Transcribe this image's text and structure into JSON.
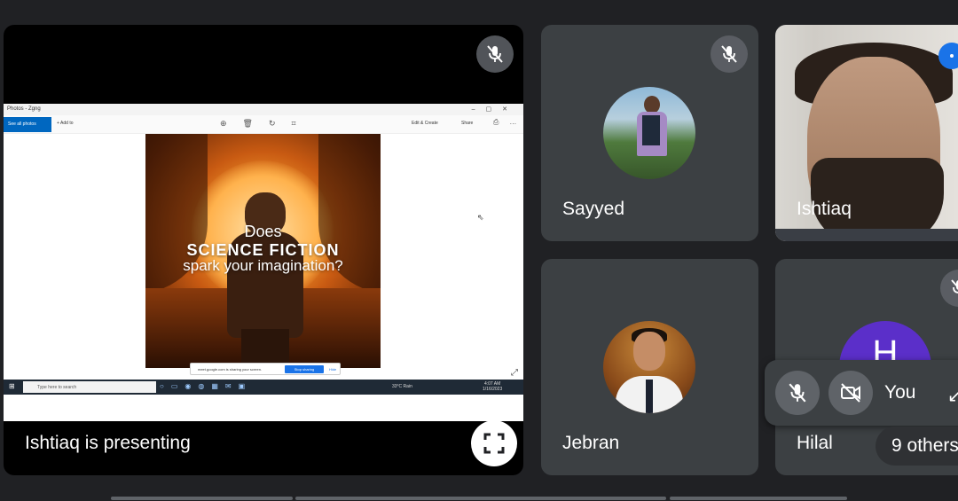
{
  "presentation": {
    "label": "Ishtiaq is presenting",
    "shared_screen": {
      "app_title": "Photos - Zgng",
      "toolbar": {
        "see_all_photos": "See all photos",
        "add_to": "+ Add to",
        "edit_create": "Edit & Create",
        "share": "Share"
      },
      "poster": {
        "line1": "Does",
        "line2": "SCIENCE FICTION",
        "line3": "spark your imagination?"
      },
      "share_bar": {
        "message": "meet.google.com is sharing your screen.",
        "stop_button": "Stop sharing",
        "hide_button": "Hide"
      },
      "taskbar": {
        "search_placeholder": "Type here to search",
        "weather": "33°C  Rain",
        "time": "4:07 AM",
        "date": "1/16/2023"
      }
    }
  },
  "participants": [
    {
      "name": "Sayyed",
      "muted": true,
      "has_photo": true
    },
    {
      "name": "Ishtiaq",
      "muted": false,
      "video_on": true
    },
    {
      "name": "Jebran",
      "muted": false,
      "has_photo": true
    },
    {
      "name": "Hilal",
      "muted": true,
      "avatar_letter": "H",
      "avatar_color": "#5b2fc9"
    }
  ],
  "self_view": {
    "label": "You",
    "mic_muted": true,
    "camera_off": true
  },
  "others_pill": "9 others",
  "colors": {
    "background": "#202124",
    "tile": "#3c4043",
    "accent_blue": "#1a73e8",
    "hilal_avatar": "#5b2fc9"
  }
}
